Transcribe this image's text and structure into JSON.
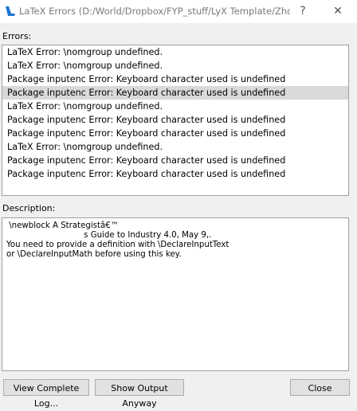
{
  "window": {
    "title": "LaTeX Errors (D:/World/Dropbox/FYP_stuff/LyX Template/Zho...",
    "help_glyph": "?",
    "close_glyph": "✕"
  },
  "errors_label": "Errors:",
  "errors": [
    "LaTeX Error: \\nomgroup undefined.",
    "LaTeX Error: \\nomgroup undefined.",
    "Package inputenc Error: Keyboard character used is undefined",
    "Package inputenc Error: Keyboard character used is undefined",
    "LaTeX Error: \\nomgroup undefined.",
    "Package inputenc Error: Keyboard character used is undefined",
    "Package inputenc Error: Keyboard character used is undefined",
    "LaTeX Error: \\nomgroup undefined.",
    "Package inputenc Error: Keyboard character used is undefined",
    "Package inputenc Error: Keyboard character used is undefined"
  ],
  "selected_error_index": 3,
  "description_label": "Description:",
  "description_text": " \\newblock A Strategistâ€™\n                              s Guide to Industry 4.0, May 9,.\nYou need to provide a definition with \\DeclareInputText\nor \\DeclareInputMath before using this key.",
  "buttons": {
    "view_log": "View Complete Log...",
    "show_output": "Show Output Anyway",
    "close": "Close"
  },
  "colors": {
    "accent_icon": "#1e73d2",
    "selected_row": "#d9d9d9"
  }
}
